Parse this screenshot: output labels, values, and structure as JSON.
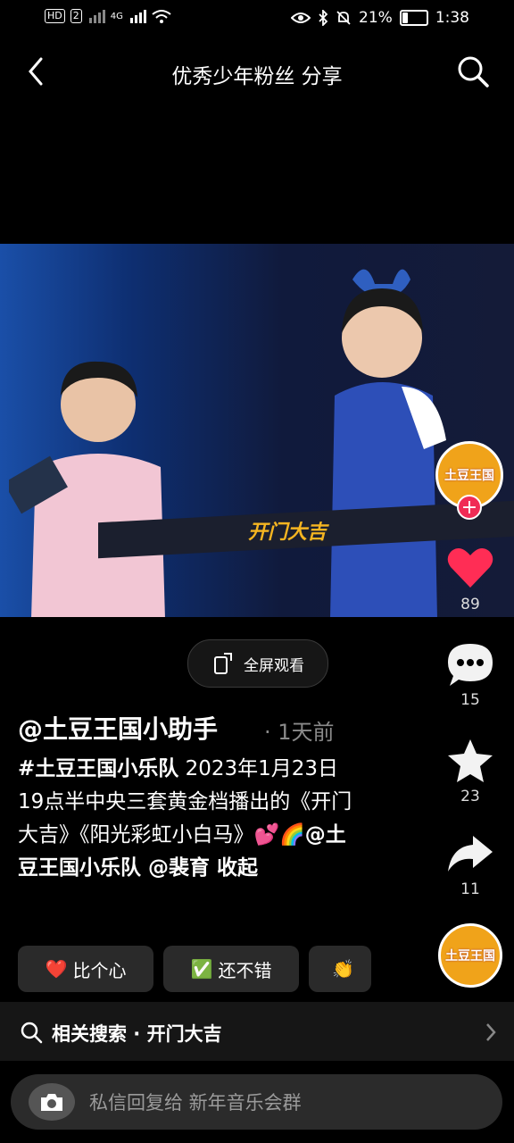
{
  "status_bar": {
    "network": "HD",
    "sim": "2",
    "signal_label": "4G",
    "battery": "21%",
    "battery_level": 0.21,
    "time": "1:38"
  },
  "nav": {
    "title": "优秀少年粉丝 分享",
    "back_icon": "chevron-left-icon",
    "search_icon": "search-icon"
  },
  "video": {
    "stage_logo": "开门大吉"
  },
  "fullscreen": {
    "label": "全屏观看"
  },
  "rail": {
    "avatar_text": "土豆王国",
    "likes": "89",
    "comments": "15",
    "favorites": "23",
    "shares": "11",
    "like_color": "#ff2d55"
  },
  "post": {
    "author": "@土豆王国小助手",
    "time": "· 1天前",
    "hashtag": "#土豆王国小乐队",
    "text": " 2023年1月23日19点半中央三套黄金档播出的《开门大吉》《阳光彩虹小白马》💕🌈",
    "mention": "@土豆王国小乐队 @裴育",
    "collapse": " 收起"
  },
  "reactions": [
    {
      "emoji": "❤️",
      "label": "比个心"
    },
    {
      "emoji": "✅",
      "label": "还不错"
    },
    {
      "emoji": "👏",
      "label": ""
    }
  ],
  "related": {
    "label": "相关搜索 · 开门大吉"
  },
  "dm": {
    "placeholder": "私信回复给 新年音乐会群"
  }
}
